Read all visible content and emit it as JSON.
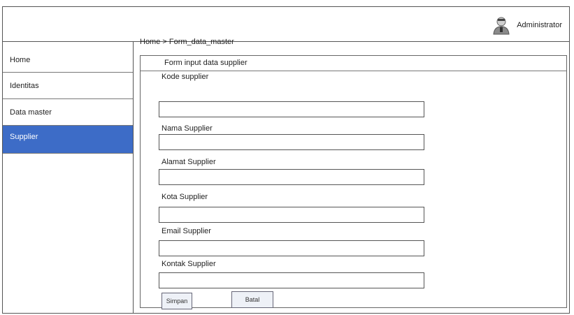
{
  "header": {
    "user_label": "Administrator",
    "user_icon": "admin-user-icon"
  },
  "sidebar": {
    "items": [
      {
        "label": "Home"
      },
      {
        "label": "Identitas"
      },
      {
        "label": "Data master"
      },
      {
        "label": "Supplier"
      }
    ],
    "active_color": "#3d6cc7"
  },
  "breadcrumb": "Home > Form_data_master",
  "form": {
    "title": "Form input data supplier",
    "fields": [
      {
        "label": "Kode supplier",
        "value": ""
      },
      {
        "label": "Nama Supplier",
        "value": ""
      },
      {
        "label": "Alamat Supplier",
        "value": ""
      },
      {
        "label": "Kota Supplier",
        "value": ""
      },
      {
        "label": "Email Supplier",
        "value": ""
      },
      {
        "label": "Kontak Supplier",
        "value": ""
      }
    ],
    "save_label": "Simpan",
    "cancel_label": "Batal"
  }
}
